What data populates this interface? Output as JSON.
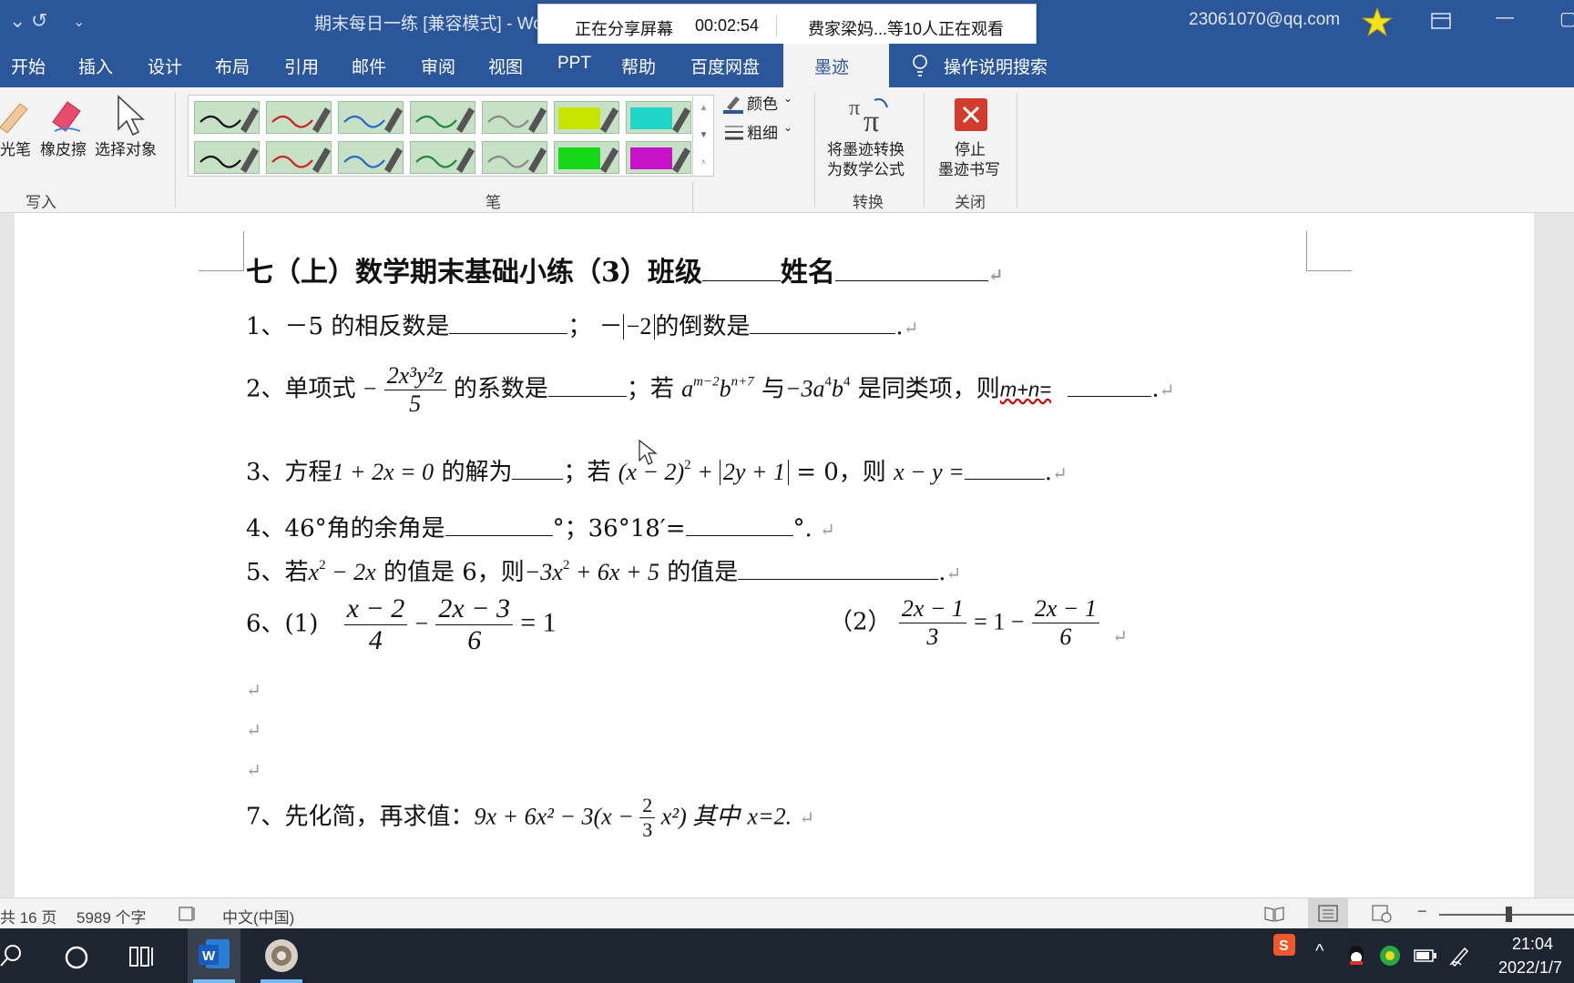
{
  "window": {
    "doc_title": "期末每日一练 [兼容模式] - Wo",
    "account": "23061070@qq.com"
  },
  "sharing_bar": {
    "status": "正在分享屏幕",
    "timer": "00:02:54",
    "viewers": "费家梁妈...等10人正在观看"
  },
  "tabs": [
    "开始",
    "插入",
    "设计",
    "布局",
    "引用",
    "邮件",
    "审阅",
    "视图",
    "PPT",
    "帮助",
    "百度网盘"
  ],
  "active_tab": "墨迹",
  "tell_me": "操作说明搜索",
  "ribbon": {
    "write_group": {
      "label": "写入",
      "highlighter": "光笔",
      "eraser": "橡皮擦",
      "select": "选择对象"
    },
    "pens_group": {
      "label": "笔",
      "color": "颜色",
      "thickness": "粗细",
      "pen_colors": [
        "#111111",
        "#d02020",
        "#2a6ac8",
        "#1f8a3a",
        "#8a8a8a",
        "#c6e600",
        "#1fd6c9",
        "#111111",
        "#d02020",
        "#2a6ac8",
        "#1f8a3a",
        "#8a8a8a",
        "#16d816",
        "#c814c8"
      ]
    },
    "convert_group": {
      "label": "转换",
      "button_line1": "将墨迹转换",
      "button_line2": "为数学公式"
    },
    "close_group": {
      "label": "关闭",
      "button_line1": "停止",
      "button_line2": "墨迹书写"
    }
  },
  "document": {
    "heading": "七（上）数学期末基础小练（3）班级",
    "heading_name": "姓名",
    "q1": {
      "num": "1、",
      "part1": "－5 的相反数是",
      "sep": "；",
      "minus": "－",
      "abs": "−2",
      "part2": "的倒数是"
    },
    "q2": {
      "num": "2、单项式",
      "neg": "−",
      "frac_num": "2x³y²z",
      "frac_den": "5",
      "text1": "的系数是",
      "text2": "；若",
      "expr1": "a",
      "expr1_sup1": "m−2",
      "expr1_b": "b",
      "expr1_sup2": "n+7",
      "text3": "与",
      "expr2": "−3a",
      "expr2_sup1": "4",
      "expr2_b": "b",
      "expr2_sup2": "4",
      "text4": "是同类项，则",
      "mn": "m+n="
    },
    "q3": {
      "num": "3、方程",
      "eq": "1 + 2x = 0",
      "text1": "的解为",
      "text2": "；若",
      "eq2a": "(x − 2)",
      "eq2_sup": "2",
      "eq2b": "+",
      "abs": "2y + 1",
      "eq2c": "= 0，则",
      "xy": "x − y ="
    },
    "q4": {
      "num": "4、46°角的余角是",
      "deg": "°；36°18′=",
      "end": "°."
    },
    "q5": {
      "num": "5、若",
      "e1": "x",
      "e1_sup": "2",
      "e1b": " − 2x",
      "text1": "的值是 6，则",
      "e2": "−3x",
      "e2_sup": "2",
      "e2b": " + 6x + 5",
      "text2": "的值是"
    },
    "q6": {
      "num": "6、(1)",
      "f1n": "x − 2",
      "f1d": "4",
      "minus": "−",
      "f2n": "2x − 3",
      "f2d": "6",
      "eq": "= 1",
      "p2": "（2）",
      "f3n": "2x − 1",
      "f3d": "3",
      "eq2": "= 1 −",
      "f4n": "2x − 1",
      "f4d": "6"
    },
    "q7": {
      "text": "7、先化简，再求值：",
      "expr": "9x + 6x² − 3(x − ",
      "frac_num": "2",
      "frac_den": "3",
      "expr_end": " x²) 其中",
      "cond": "x=2."
    },
    "pilcrow": "↵"
  },
  "status_bar": {
    "pages": "共 16 页",
    "words": "5989 个字",
    "language": "中文(中国)"
  },
  "taskbar": {
    "time": "21:04",
    "date": "2022/1/7"
  }
}
